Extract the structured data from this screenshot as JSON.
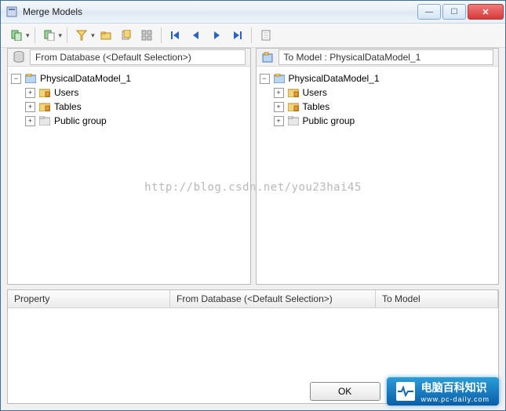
{
  "window": {
    "title": "Merge Models"
  },
  "panels": {
    "from": {
      "label": "From Database (<Default Selection>)",
      "tree": {
        "root": "PhysicalDataModel_1",
        "children": [
          "Users",
          "Tables",
          "Public group"
        ]
      }
    },
    "to": {
      "label": "To Model : PhysicalDataModel_1",
      "tree": {
        "root": "PhysicalDataModel_1",
        "children": [
          "Users",
          "Tables",
          "Public group"
        ]
      }
    }
  },
  "grid": {
    "columns": [
      "Property",
      "From Database (<Default Selection>)",
      "To Model"
    ]
  },
  "footer": {
    "ok_label": "OK",
    "badge": {
      "title": "电脑百科知识",
      "subtitle": "www.pc-daily.com"
    }
  },
  "watermark": "http://blog.csdn.net/you23hai45"
}
